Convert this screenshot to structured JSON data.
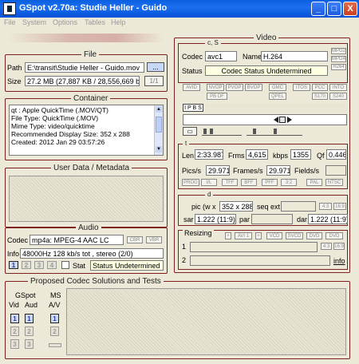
{
  "window": {
    "title": "GSpot v2.70a: Studie Heller - Guido",
    "controls": {
      "minimize": "_",
      "maximize": "□",
      "close": "X"
    }
  },
  "menu": [
    "File",
    "System",
    "Options",
    "Tables",
    "Help"
  ],
  "file": {
    "title": "File",
    "path_label": "Path",
    "path_value": "E:\\transit\\Studie Heller - Guido.mov",
    "browse_label": "...",
    "size_label": "Size",
    "size_value": "27.2 MB (27,887 KB / 28,556,669 b",
    "part_label": "1/1"
  },
  "container": {
    "title": "Container",
    "lines": [
      "qt : Apple QuickTime (.MOV/QT)",
      "File Type: QuickTime (.MOV)",
      "Mime Type: video/quicktime",
      "Recommended Display Size: 352 x 288",
      "Created:    2012 Jan 29  03:57:26"
    ]
  },
  "userdata": {
    "title": "User Data / Metadata"
  },
  "audio": {
    "title": "Audio",
    "codec_label": "Codec",
    "codec_value": "mp4a: MPEG-4 AAC LC",
    "cbr_label": "CBR",
    "vbr_label": "VBR",
    "info_label": "Info",
    "info_value": "48000Hz  128 kb/s tot , stereo (2/0)",
    "stream_buttons": [
      "1",
      "2",
      "3",
      "4"
    ],
    "stat_label": "Stat",
    "stat_value": "Status Undetermined"
  },
  "video": {
    "title": "Video",
    "cs_label": "c, S",
    "codec_label": "Codec",
    "codec_value": "avc1",
    "name_label": "Name",
    "name_value": "H.264",
    "tag_buttons": [
      "MPG2",
      "MPG4",
      "H264"
    ],
    "status_label": "Status",
    "status_value": "Codec Status Undetermined",
    "flag_row1": [
      "AVID",
      "NVOP",
      "PVOP",
      "BVOP",
      "GMC",
      "ITOS",
      "PCC",
      "INTO"
    ],
    "flag_row2": [
      "PB DF",
      "QPEL",
      "S170",
      "S240"
    ],
    "ipbs_label": "I P B S",
    "t_label": "t",
    "len_label": "Len",
    "len_value": "2:33.987",
    "frms_label": "Frms",
    "frms_value": "4,615",
    "kbps_label": "kbps",
    "kbps_value": "1355",
    "qf_label": "Qf",
    "qf_value": "0.446",
    "pics_label": "Pics/s",
    "pics_value": "29.971",
    "frames_label": "Frames/s",
    "frames_value": "29.971",
    "fields_label": "Fields/s",
    "fields_value": "",
    "ttf_row": [
      "PROG",
      "I/L",
      "TFF",
      "BFF",
      "PFF",
      "3:2",
      "PAL",
      "NTSC"
    ],
    "d_label": "d",
    "pic_label": "pic (w x",
    "pic_value": "352 x 288",
    "seq_label": "seq ext",
    "seq_value": "",
    "ar_buttons": [
      "4:3",
      "16:9"
    ],
    "sar_label": "sar",
    "sar_value": "1.222 (11:9)",
    "par_label": "par",
    "par_value": "",
    "dar_label": "dar",
    "dar_value": "1.222 (11:9)",
    "resizing_label": "Resizing",
    "resize_buttons": [
      "+",
      "AVI 1",
      "+",
      "VCD",
      "SVCD",
      "DVD",
      "DVD"
    ],
    "resize_sub": [
      "4:3",
      "16:9"
    ],
    "row1_label": "1",
    "row2_label": "2",
    "info_link": "info"
  },
  "proposed": {
    "title": "Proposed Codec Solutions and Tests",
    "gspot_label": "GSpot",
    "vid_label": "Vid",
    "aud_label": "Aud",
    "ms_label": "MS",
    "av_label": "A/V",
    "rows": [
      "1",
      "2",
      "3"
    ]
  }
}
